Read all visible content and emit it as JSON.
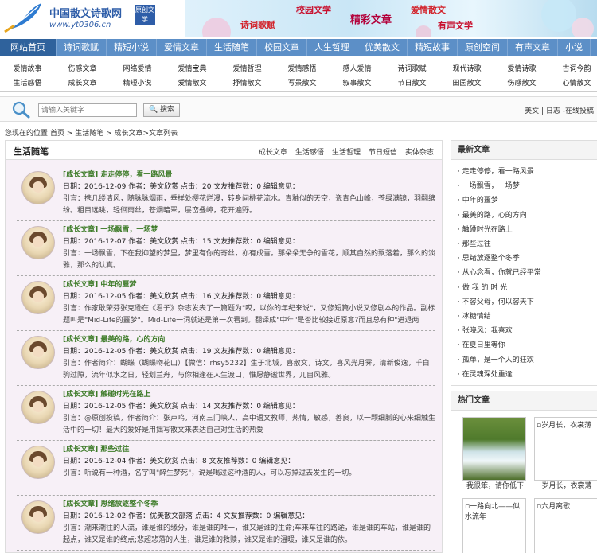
{
  "logo": {
    "title": "中国散文诗歌网",
    "badge": "原创文学",
    "url": "www.yt0306.cn"
  },
  "banner": {
    "words": [
      "诗词歌赋",
      "校园文学",
      "精彩文章",
      "爱情散文",
      "有声文学"
    ],
    "colors": [
      "#d2222a",
      "#c8102e",
      "#b3003a",
      "#d2222a",
      "#c8102e"
    ]
  },
  "nav": {
    "items": [
      "网站首页",
      "诗词歌赋",
      "精短小说",
      "爱情文章",
      "生活随笔",
      "校园文章",
      "人生哲理",
      "优美散文",
      "精短故事",
      "原创空间",
      "有声文章",
      "小说"
    ],
    "active_index": 0
  },
  "subnav": {
    "row1": [
      "爱情故事",
      "伤感文章",
      "网络爱情",
      "爱情宝典",
      "爱情哲理",
      "爱情感悟",
      "感人爱情",
      "诗词歌赋",
      "现代诗歌",
      "爱情诗歌",
      "古词今韵"
    ],
    "row2": [
      "生活感悟",
      "成长文章",
      "精短小说",
      "爱情散文",
      "抒情散文",
      "写景散文",
      "叙事散文",
      "节日散文",
      "田园散文",
      "伤感散文",
      "心情散文"
    ]
  },
  "search": {
    "placeholder": "请输入关键字",
    "button_label": "搜索",
    "right_links": "美文 | 日志 -在线投稿"
  },
  "breadcrumb": "您现在的位置:首页 > 生活随笔 > 成长文章>文章列表",
  "main": {
    "title": "生活随笔",
    "tabs": [
      "成长文章",
      "生活感悟",
      "生活哲理",
      "节日短信",
      "实体杂志"
    ],
    "articles": [
      {
        "title": "[成长文章] 走走停停，看一路风景",
        "meta": "日期：2016-12-09 作者：美文欣赏 点击：20 文友推荐数：0 编辑意见：",
        "intro": "引言：携几缕清风，随脉脉烟雨，垂样处樱花烂漫，转身间桃花流水。青釉似的天空，瓷青色山峰，苍绿满镜，羽翻缤纷。粗目远眺，轻徊雨丝，苍烟暗翠，层峦叠嶂，花开遍野。"
      },
      {
        "title": "[成长文章] 一场飘雪，一场梦",
        "meta": "日期：2016-12-07 作者：美文欣赏 点击：15 文友推荐数：0 编辑意见：",
        "intro": "引言：一场飘雪，下在我抑望的梦里，梦里有你的寄丝，亦有成雪。那朵朵无争的雪花，顺其自然的飘落着，那么的淡雅，那么的认真。"
      },
      {
        "title": "[成长文章] 中年的噩梦",
        "meta": "日期：2016-12-05 作者：美文欣赏 点击：16 文友推荐数：0 编辑意见：",
        "intro": "引言：作家耿荣芬张克逊在《君子》杂志发表了一篇题为\"哎，以你的年纪来说\"，又修短篇小说又修剧本的作品。副标题叫是\"Mid-Life的噩梦\"。Mid-Life一词就还是第一次看到。翻译成\"中年\"是否比较接近原意?而且总有种\"进退两难\"的感觉。"
      },
      {
        "title": "[成长文章] 最美的路，心的方向",
        "meta": "日期：2016-12-05 作者：美文欣赏 点击：19 文友推荐数：0 编辑意见：",
        "intro": "引言：作者简介：蝴蝶（蝴蝶吻花山）【微信：rhsy5232】生于北城，喜散文，诗文，喜风光月霁，清新俊逸，千白驹过隙，流年似水之日，轻划兰舟，与你相逢在人生渡口，惟愿静谧世界，兀自风雅。"
      },
      {
        "title": "[成长文章] 触碰时光在路上",
        "meta": "日期：2016-12-05 作者：美文欣赏 点击：14 文友推荐数：0 编辑意见：",
        "intro": "引言：@原创投稿，作者简介：张卢鸣，河南三门峡人，高中语文教师，热情，敏感，善良，以一颗细腻的心来细触生活中的一切！最大的爱好是用拙写散文来表达自己对生活的热爱"
      },
      {
        "title": "[成长文章] 那些过往",
        "meta": "日期：2016-12-04 作者：美文欣赏 点击：8 文友推荐数：0 编辑意见：",
        "intro": "引言：听说有一种酒，名字叫\"醉生梦死\"，说是喝过这种酒的人，可以忘掉过去发生的一切。"
      },
      {
        "title": "[成长文章] 思绪放逐整个冬季",
        "meta": "日期：2016-12-02 作者：优美散文部落 点击：4 文友推荐数：0 编辑意见：",
        "intro": "引言：潮来潮往的人流，谁是谁的缘分，谁是谁的唯一，谁又是谁的生命;车来车往的路途，谁是谁的车站，谁是谁的起点，谁又是谁的终点;悲超悲落的人生，谁是谁的救赎，谁又是谁的温暖，谁又是谁的依。"
      }
    ]
  },
  "side": {
    "latest_title": "最新文章",
    "latest": [
      "走走停停，看一路风景",
      "一场飘雪，一场梦",
      "中年的噩梦",
      "最美的路，心的方向",
      "触碰时光在路上",
      "那些过往",
      "思绪放逐整个冬季",
      "从心念看，你就已经平常",
      "做 我 的 时 光",
      "不容父母，何以容天下",
      "冰糖情结",
      "张晓风：我喜欢",
      "在夏日里等你",
      "孤单，是一个人的狂欢",
      "在灵魂深处重逢"
    ],
    "hot_title": "热门文章",
    "hot": [
      {
        "img_alt": "",
        "caption": "我很笨，请你低下"
      },
      {
        "img_alt": "岁月长，衣裳薄",
        "caption": "岁月长，衣裳薄"
      },
      {
        "img_alt": "一路向北——似水流年",
        "caption": "一路向北——似水"
      },
      {
        "img_alt": "六月离歌",
        "caption": "六月离歌"
      }
    ]
  }
}
